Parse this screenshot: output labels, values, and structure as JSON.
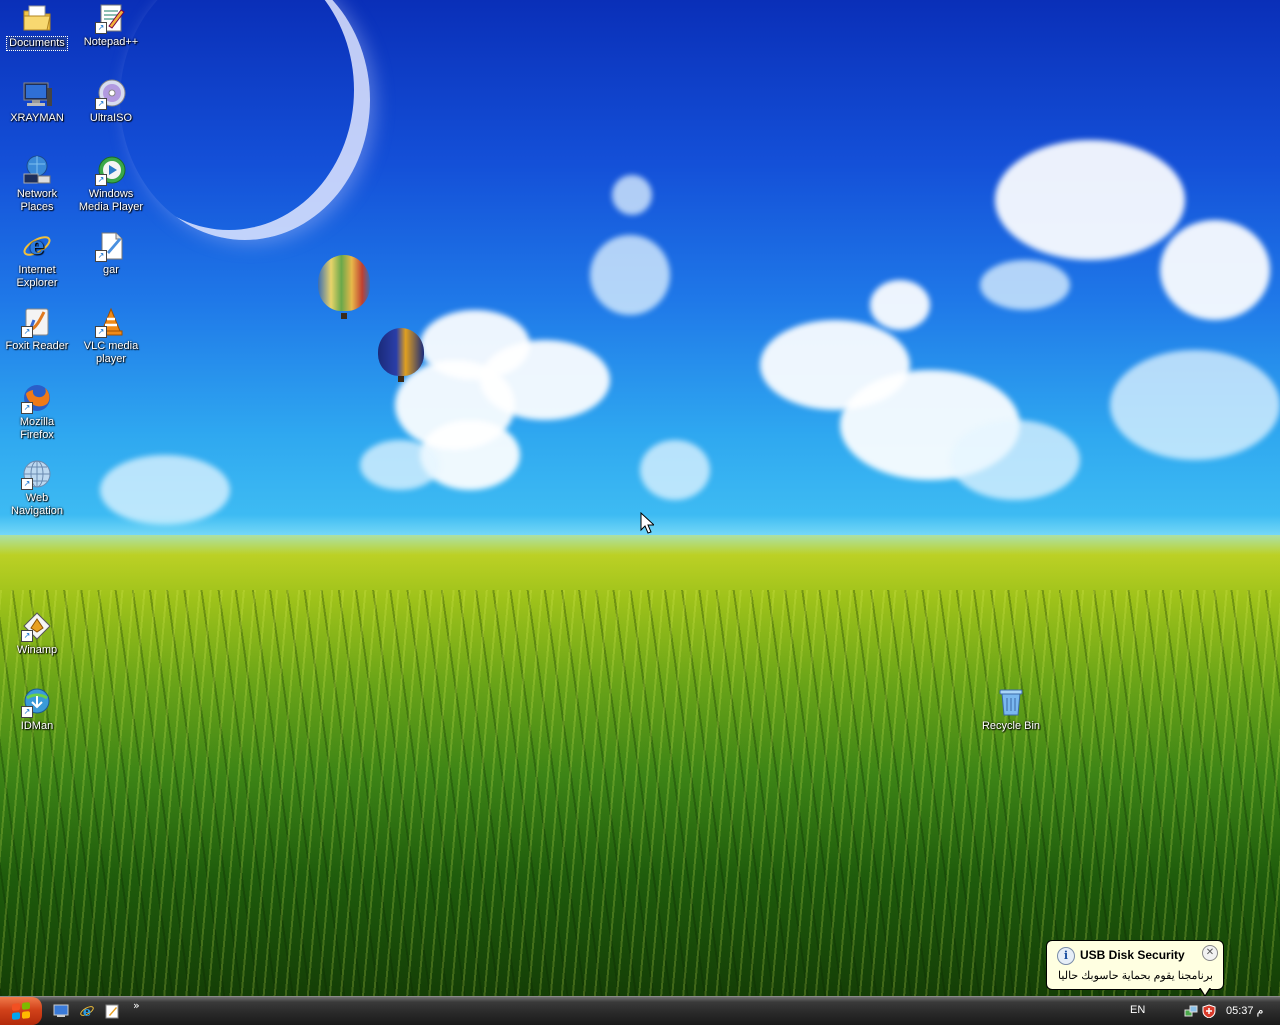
{
  "desktop": {
    "icons_left": [
      {
        "id": "documents",
        "label": "Documents",
        "icon": "folder-icon",
        "selected": true
      },
      {
        "id": "notepadpp",
        "label": "Notepad++",
        "icon": "notepad-icon"
      },
      {
        "id": "xrayman",
        "label": "XRAYMAN",
        "icon": "computer-icon"
      },
      {
        "id": "ultraiso",
        "label": "UltraISO",
        "icon": "disc-icon"
      },
      {
        "id": "network",
        "label": "Network Places",
        "icon": "network-icon"
      },
      {
        "id": "wmp",
        "label": "Windows Media Player",
        "icon": "media-player-icon"
      },
      {
        "id": "ie",
        "label": "Internet Explorer",
        "icon": "internet-explorer-icon"
      },
      {
        "id": "gar",
        "label": "gar",
        "icon": "document-icon"
      },
      {
        "id": "foxit",
        "label": "Foxit Reader",
        "icon": "pdf-reader-icon"
      },
      {
        "id": "vlc",
        "label": "VLC media player",
        "icon": "vlc-cone-icon"
      },
      {
        "id": "firefox",
        "label": "Mozilla Firefox",
        "icon": "firefox-icon"
      },
      {
        "id": "webnav",
        "label": "Web Navigation",
        "icon": "globe-icon"
      },
      {
        "id": "winamp",
        "label": "Winamp",
        "icon": "winamp-icon"
      },
      {
        "id": "idman",
        "label": "IDMan",
        "icon": "download-manager-icon"
      }
    ],
    "recycle_bin": {
      "label": "Recycle Bin",
      "icon": "recycle-bin-icon"
    }
  },
  "notification": {
    "title": "USB Disk Security",
    "message": "برنامجنا يقوم بحماية حاسوبك حاليا",
    "icon": "info-icon",
    "close": "close-icon"
  },
  "taskbar": {
    "start_icon": "windows-flag-icon",
    "quick_launch": [
      "show-desktop-icon",
      "internet-explorer-icon",
      "notepad-icon"
    ],
    "more": "»",
    "language": "EN",
    "tray_icons": [
      "network-tray-icon",
      "usb-security-tray-icon"
    ],
    "clock": "05:37 م"
  },
  "colors": {
    "sky_top": "#0a2fb8",
    "sky_horizon": "#43c2f4",
    "field_top": "#c9d72a",
    "field_bottom": "#143e06",
    "start_button": "#d2421a",
    "taskbar": "#2a2a2a",
    "balloon_bg": "#ffffe1"
  }
}
